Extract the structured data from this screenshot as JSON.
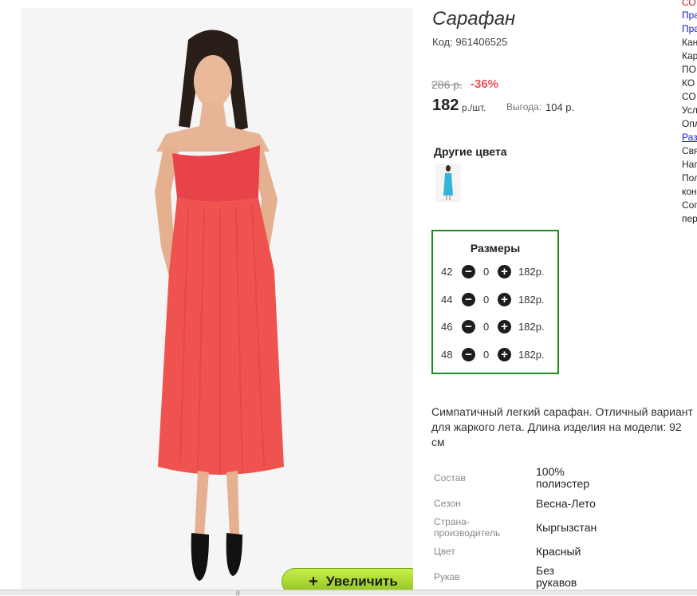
{
  "product": {
    "title": "Сарафан",
    "code": "Код: 961406525",
    "old_price": "286 р.",
    "discount": "-36%",
    "price": "182",
    "price_unit": "р./шт.",
    "benefit_label": "Выгода:",
    "benefit_value": "104 р.",
    "other_colors_title": "Другие цвета",
    "zoom_label": "Увеличить",
    "zoom_icon": "plus-icon",
    "photo_color": "#ef5350",
    "thumb_color": "#33b5d6"
  },
  "sizes": {
    "title": "Размеры",
    "rows": [
      {
        "size": "42",
        "qty": "0",
        "price": "182р."
      },
      {
        "size": "44",
        "qty": "0",
        "price": "182р."
      },
      {
        "size": "46",
        "qty": "0",
        "price": "182р."
      },
      {
        "size": "48",
        "qty": "0",
        "price": "182р."
      }
    ]
  },
  "description": "Симпатичный легкий сарафан. Отличный вариант для жаркого лета. Длина изделия на модели: 92 см",
  "attributes": [
    {
      "label": "Состав",
      "value": "100% полиэстер"
    },
    {
      "label": "Сезон",
      "value": "Весна-Лето"
    },
    {
      "label": "Страна-производитель",
      "value": "Кыргызстан"
    },
    {
      "label": "Цвет",
      "value": "Красный"
    },
    {
      "label": "Рукав",
      "value": "Без рукавов"
    }
  ],
  "side_menu": [
    "СО",
    "Пра",
    "Пра",
    "Кан",
    "Кар",
    "ПО",
    "КО",
    "СО",
    "Усл",
    "Опл",
    "Раз",
    "Свя",
    "Наг",
    "Пол",
    "кон",
    "Сог",
    "пер"
  ]
}
